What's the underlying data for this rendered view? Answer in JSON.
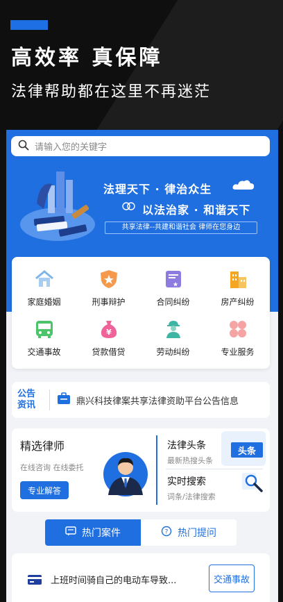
{
  "promo": {
    "title": "高效率 真保障",
    "subtitle": "法律帮助都在这里不再迷茫"
  },
  "search": {
    "placeholder": "请输入您的关键字"
  },
  "banner": {
    "slogan_line1": "法理天下 · 律治众生",
    "slogan_line2": "以法治家 · 和谐天下",
    "slogan_line3": "共享法律--共建和谐社会 律师在您身边"
  },
  "services": [
    {
      "label": "家庭婚姻",
      "icon": "house-icon"
    },
    {
      "label": "刑事辩护",
      "icon": "shield-star-icon"
    },
    {
      "label": "合同纠纷",
      "icon": "contract-icon"
    },
    {
      "label": "房产纠纷",
      "icon": "buildings-icon"
    },
    {
      "label": "交通事故",
      "icon": "bus-icon"
    },
    {
      "label": "贷款借贷",
      "icon": "money-bag-icon"
    },
    {
      "label": "劳动纠纷",
      "icon": "worker-icon"
    },
    {
      "label": "专业服务",
      "icon": "flower-grid-icon"
    }
  ],
  "notice": {
    "tag_line1": "公告",
    "tag_line2": "资讯",
    "text": "鼎兴科技律案共享法律资助平台公告信息"
  },
  "lawyer": {
    "title": "精选律师",
    "subtitle": "在线咨询 在线委托",
    "button": "专业解答"
  },
  "headlines": {
    "title": "法律头条",
    "subtitle": "最新热搜头条",
    "badge": "头条"
  },
  "search_panel": {
    "title": "实时搜索",
    "subtitle": "词条/法律搜索"
  },
  "tabs": [
    {
      "label": "热门案件",
      "active": true
    },
    {
      "label": "热门提问",
      "active": false
    }
  ],
  "case_item": {
    "text": "上班时间骑自己的电动车导致...",
    "tag": "交通事故"
  },
  "colors": {
    "brand_blue": "#1f6fe0",
    "accent_blue": "#1e6fe3"
  }
}
